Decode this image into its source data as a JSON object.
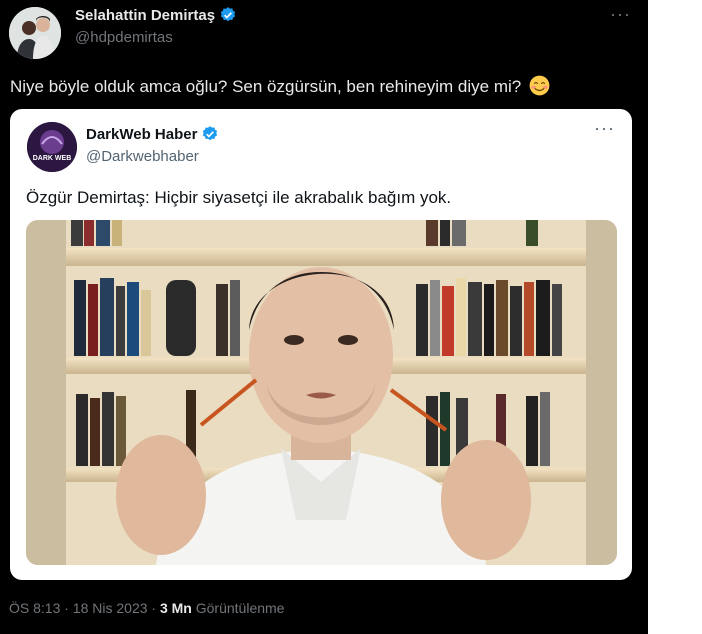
{
  "tweet": {
    "author": {
      "display_name": "Selahattin Demirtaş",
      "handle": "@hdpdemirtas"
    },
    "text": "Niye böyle olduk amca oğlu? Sen özgürsün, ben rehineyim diye mi?",
    "emoji": "smiling-face-emoji",
    "menu_label": "···"
  },
  "quoted": {
    "author": {
      "display_name": "DarkWeb Haber",
      "handle": "@Darkwebhaber"
    },
    "avatar_text": "DARK WEB",
    "text": "Özgür Demirtaş: Hiçbir siyasetçi ile akrabalık bağım yok.",
    "menu_label": "···"
  },
  "meta": {
    "timestamp": "ÖS 8:13 · 18 Nis 2023 · ",
    "views_count": "3 Mn",
    "views_label": "Görüntülenme"
  },
  "colors": {
    "background": "#000000",
    "verified": "#1d9bf0",
    "text_primary": "#e7e9ea",
    "text_secondary": "#71767b"
  }
}
